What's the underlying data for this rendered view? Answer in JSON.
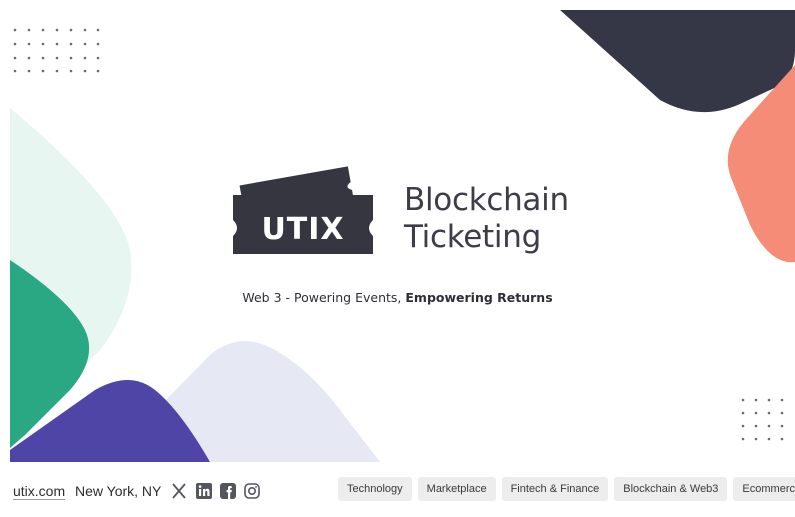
{
  "brand": {
    "logo_text": "UTIX",
    "title_line1": "Blockchain",
    "title_line2": "Ticketing"
  },
  "tagline": {
    "regular": "Web 3 - Powering Events, ",
    "bold": "Empowering Returns"
  },
  "footer": {
    "website": "utix.com",
    "location": "New York, NY",
    "social_icons": [
      "x-icon",
      "linkedin-icon",
      "facebook-icon",
      "instagram-icon"
    ],
    "tags": [
      "Technology",
      "Marketplace",
      "Fintech & Finance",
      "Blockchain & Web3",
      "Ecommerce"
    ]
  },
  "colors": {
    "navy": "#363746",
    "coral": "#f48c78",
    "green": "#2aa783",
    "mint": "#e7f6f0",
    "indigo": "#4f45a7",
    "lavender": "#e6e8f4",
    "ticket": "#363640"
  }
}
